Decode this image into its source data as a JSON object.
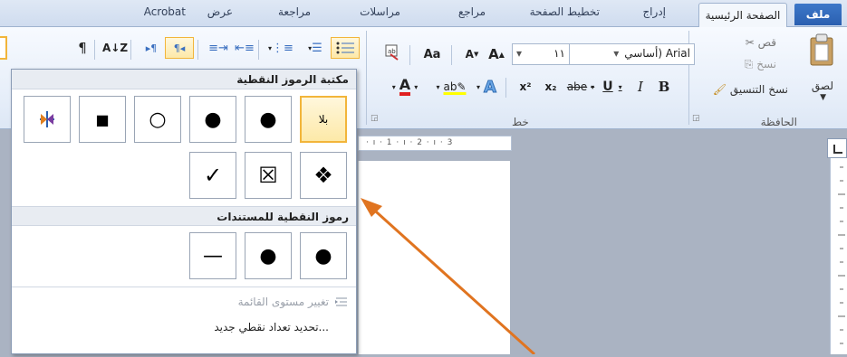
{
  "tabs": {
    "file": "ملف",
    "home": "الصفحة الرئيسية",
    "insert": "إدراج",
    "page_layout": "تخطيط الصفحة",
    "references": "مراجع",
    "mailings": "مراسلات",
    "review": "مراجعة",
    "view": "عرض",
    "acrobat": "Acrobat"
  },
  "clipboard": {
    "paste": "لصق",
    "cut": "قص",
    "copy": "نسخ",
    "format_painter": "نسخ التنسيق",
    "group_label": "الحافظة"
  },
  "font": {
    "font_name": "Arial (أساسي",
    "font_size": "١١",
    "group_label": "خط",
    "bold": "B",
    "italic": "I",
    "underline": "U",
    "strike": "abe",
    "subscript": "x₂",
    "superscript": "x²",
    "grow": "A",
    "shrink": "A",
    "change_case": "Aa"
  },
  "ruler": {
    "marks": "· ı · 1 · ı · 2 · ı · 3"
  },
  "bullet_library": {
    "header": "مكتبة الرموز النقطية",
    "none_label": "بلا",
    "row1": [
      "●",
      "●",
      "○",
      "■",
      "⁜"
    ],
    "row2": [
      "❖",
      "☒",
      "✓"
    ]
  },
  "document_bullets": {
    "header": "رموز النقطية للمستندات",
    "items": [
      "●",
      "●",
      "—"
    ]
  },
  "menu": {
    "change_level": "تغيير مستوى القائمة",
    "define_new": "تحديد تعداد نقطي جديد..."
  },
  "colors": {
    "accent_file": "#2a5fb0",
    "selection": "#f2b53a",
    "arrow": "#e07420"
  }
}
